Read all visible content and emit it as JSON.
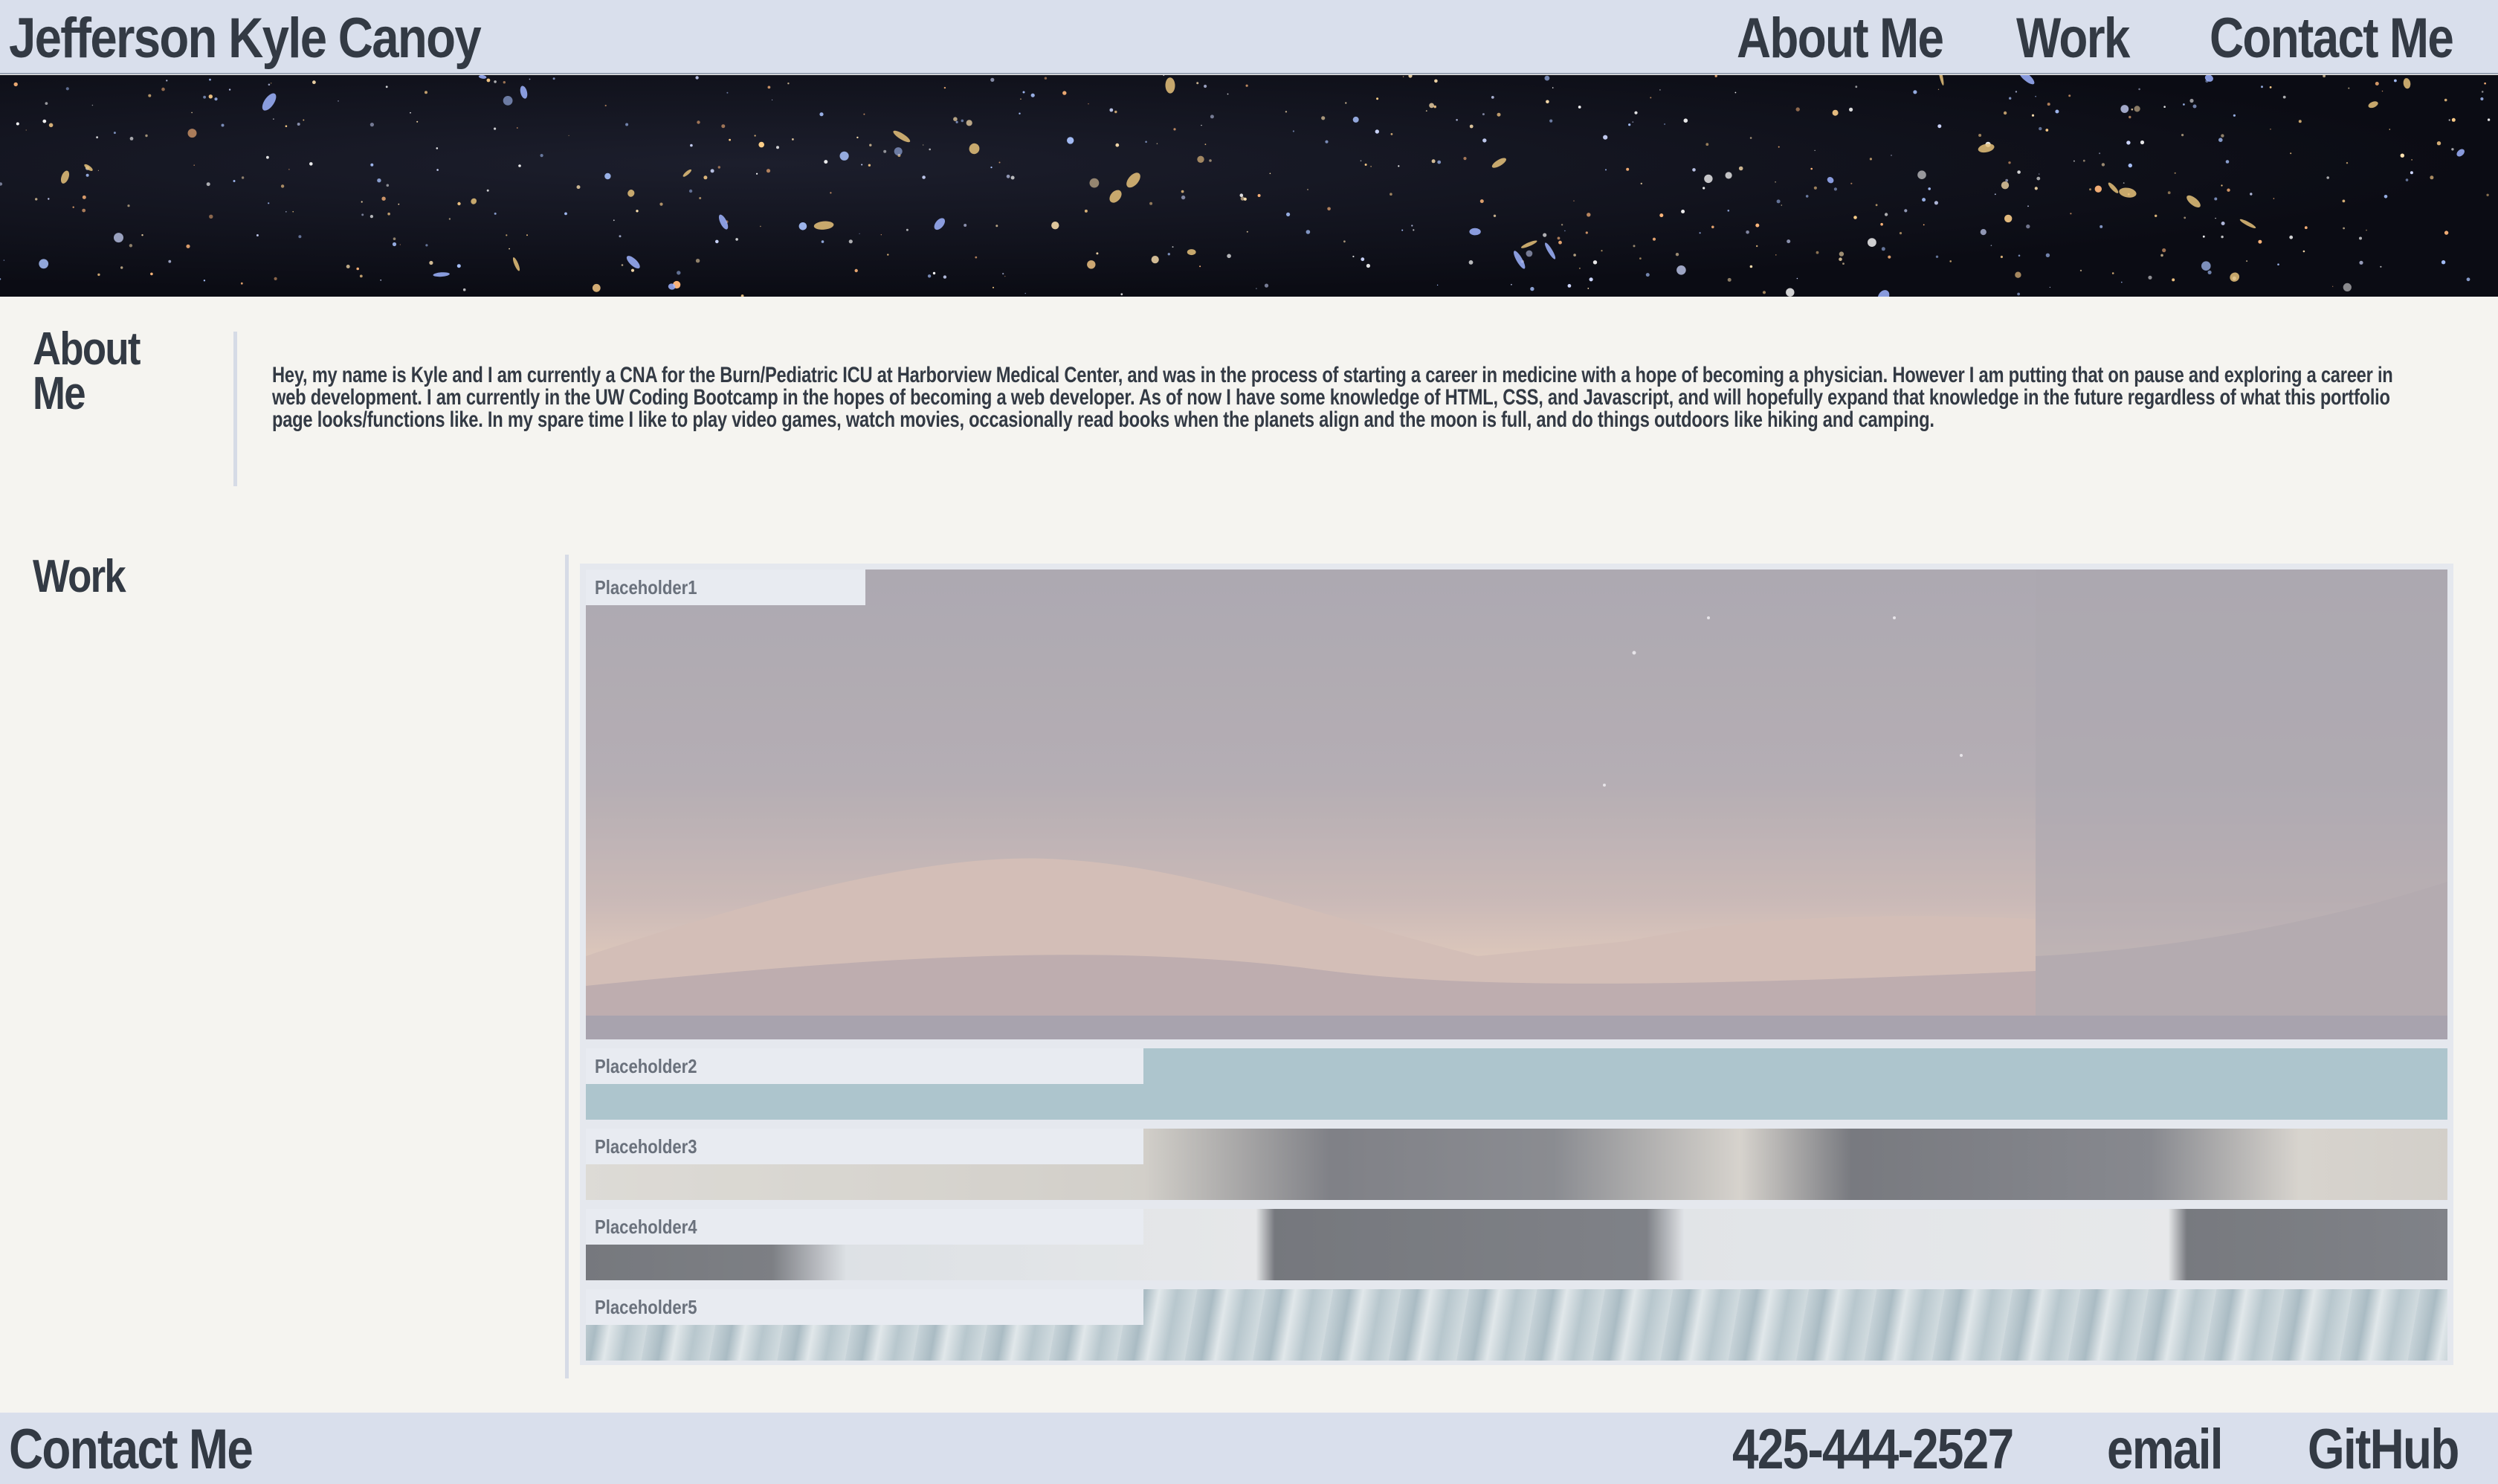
{
  "header": {
    "title": "Jefferson Kyle Canoy",
    "nav": [
      "About Me",
      "Work",
      "Contact Me"
    ]
  },
  "banner": {
    "image": "galaxy-starfield"
  },
  "about": {
    "heading": "About Me",
    "text": "Hey, my name is Kyle and I am currently a CNA for the Burn/Pediatric ICU at Harborview Medical Center, and was in the process of starting a career in medicine with a hope of becoming a physician. However I am putting that on pause and exploring a career in web development. I am currently in the UW Coding Bootcamp in the hopes of becoming a web developer. As of now I have some knowledge of HTML, CSS, and Javascript, and will hopefully expand that knowledge in the future regardless of what this portfolio page looks/functions like. In my spare time I like to play video games, watch movies, occasionally read books when the planets align and the moon is full, and do things outdoors like hiking and camping."
  },
  "work": {
    "heading": "Work",
    "tiles": [
      {
        "label": "Placeholder1",
        "image": "desert-dunes"
      },
      {
        "label": "Placeholder2",
        "image": "teal-color"
      },
      {
        "label": "Placeholder3",
        "image": "dog-photo"
      },
      {
        "label": "Placeholder4",
        "image": "dog-photo"
      },
      {
        "label": "Placeholder5",
        "image": "ocean-waves"
      }
    ]
  },
  "footer": {
    "title": "Contact Me",
    "phone": "425-444-2527",
    "email": "email",
    "github": "GitHub"
  }
}
